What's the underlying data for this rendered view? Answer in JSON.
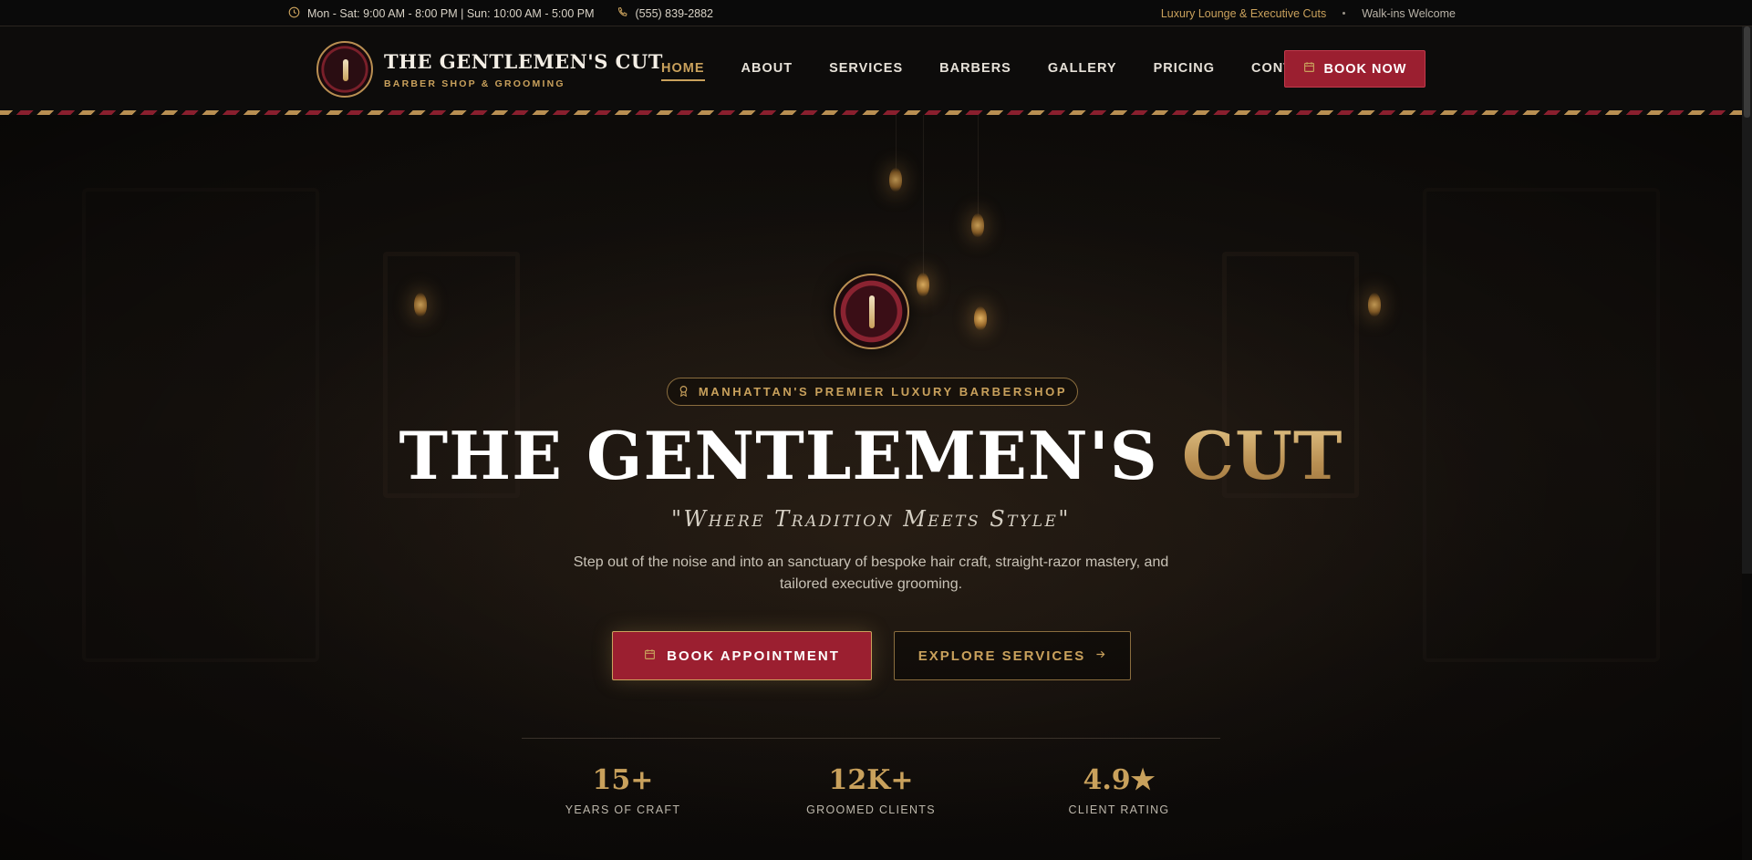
{
  "topbar": {
    "hours": "Mon - Sat: 9:00 AM - 8:00 PM | Sun: 10:00 AM - 5:00 PM",
    "phone": "(555) 839-2882",
    "lounge": "Luxury Lounge & Executive Cuts",
    "walkins": "Walk-ins Welcome",
    "icons": {
      "hours": "clock-icon",
      "phone": "phone-icon"
    }
  },
  "brand": {
    "name": "THE GENTLEMEN'S CUT",
    "tagline": "BARBER SHOP & GROOMING"
  },
  "nav": {
    "items": [
      {
        "label": "HOME",
        "active": true
      },
      {
        "label": "ABOUT",
        "active": false
      },
      {
        "label": "SERVICES",
        "active": false
      },
      {
        "label": "BARBERS",
        "active": false
      },
      {
        "label": "GALLERY",
        "active": false
      },
      {
        "label": "PRICING",
        "active": false
      },
      {
        "label": "CONTACT",
        "active": false
      }
    ],
    "book_label": "BOOK NOW"
  },
  "hero": {
    "badge": "MANHATTAN'S PREMIER LUXURY BARBERSHOP",
    "title_main": "THE GENTLEMEN'S",
    "title_accent": "CUT",
    "tagline": "\"Where Tradition Meets Style\"",
    "lead": "Step out of the noise and into an sanctuary of bespoke hair craft, straight-razor mastery, and tailored executive grooming.",
    "primary_cta": "BOOK APPOINTMENT",
    "secondary_cta": "EXPLORE SERVICES",
    "stats": [
      {
        "value": "15+",
        "label": "YEARS OF CRAFT"
      },
      {
        "value": "12K+",
        "label": "GROOMED CLIENTS"
      },
      {
        "value": "4.9★",
        "label": "CLIENT RATING"
      }
    ]
  },
  "colors": {
    "gold": "#c9a15c",
    "crimson": "#9b1f30",
    "background": "#0b0a09"
  }
}
